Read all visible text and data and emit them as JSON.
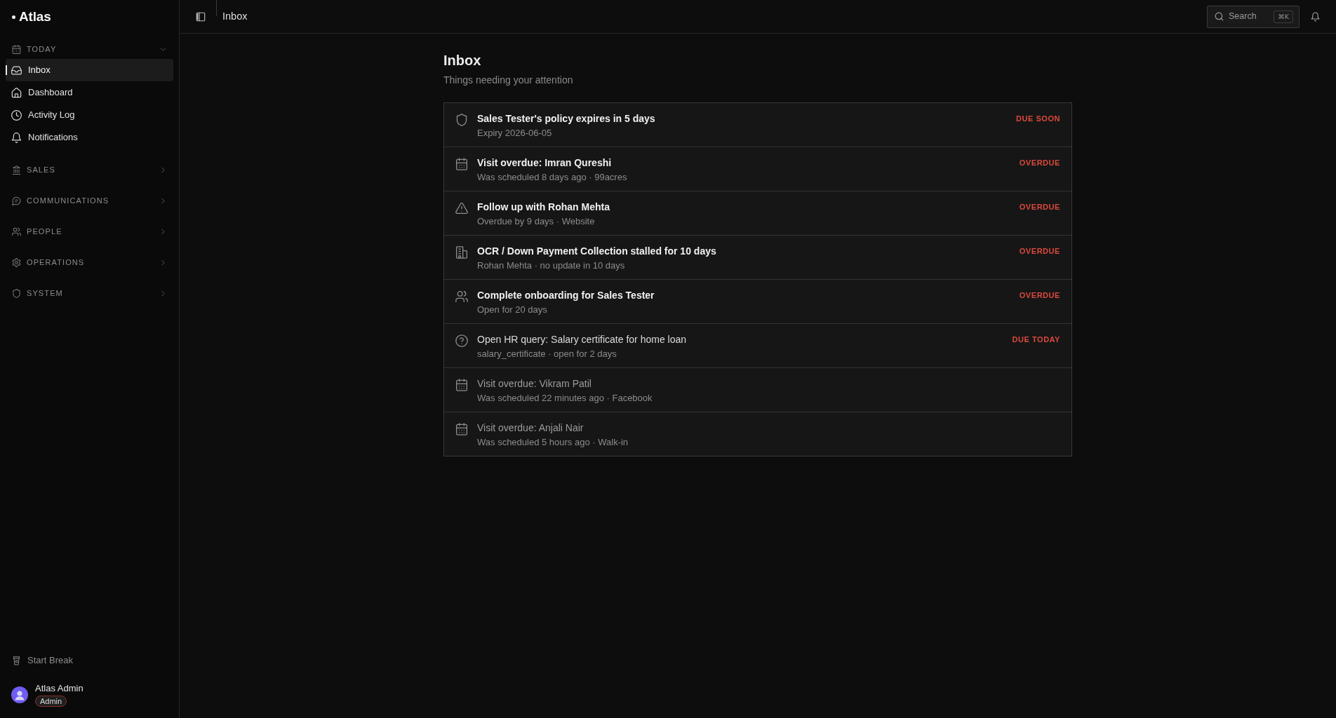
{
  "sidebar": {
    "logo": "Atlas",
    "groups": [
      {
        "kind": "today",
        "label": "TODAY",
        "expanded": true,
        "items": [
          {
            "kind": "inbox",
            "label": "Inbox",
            "selected": true
          },
          {
            "kind": "dashboard",
            "label": "Dashboard",
            "selected": false
          },
          {
            "kind": "activity",
            "label": "Activity Log",
            "selected": false
          },
          {
            "kind": "notifications",
            "label": "Notifications",
            "selected": false
          }
        ]
      },
      {
        "kind": "sales",
        "label": "SALES",
        "expanded": false
      },
      {
        "kind": "communications",
        "label": "COMMUNICATIONS",
        "expanded": false
      },
      {
        "kind": "people",
        "label": "PEOPLE",
        "expanded": false
      },
      {
        "kind": "operations",
        "label": "OPERATIONS",
        "expanded": false
      },
      {
        "kind": "system",
        "label": "SYSTEM",
        "expanded": false
      }
    ],
    "footer": {
      "break_button": "Start Break",
      "user": {
        "name": "Atlas Admin",
        "role": "Admin"
      }
    }
  },
  "topbar": {
    "title": "Inbox",
    "search": {
      "label": "Search",
      "shortcut": "⌘K"
    }
  },
  "page": {
    "title": "Inbox",
    "subtitle": "Things needing your attention"
  },
  "inbox_items": [
    {
      "kind": "policy",
      "title": "Sales Tester's policy expires in 5 days",
      "detail": "Expiry 2026-06-05",
      "status": "DUE SOON",
      "unread": true,
      "dimmed": false
    },
    {
      "kind": "visit",
      "title": "Visit overdue: Imran Qureshi",
      "detail": "Was scheduled 8 days ago · 99acres",
      "status": "OVERDUE",
      "unread": true,
      "dimmed": false
    },
    {
      "kind": "followup",
      "title": "Follow up with Rohan Mehta",
      "detail": "Overdue by 9 days · Website",
      "status": "OVERDUE",
      "unread": true,
      "dimmed": false
    },
    {
      "kind": "stalled",
      "title": "OCR / Down Payment Collection stalled for 10 days",
      "detail": "Rohan Mehta · no update in 10 days",
      "status": "OVERDUE",
      "unread": true,
      "dimmed": false
    },
    {
      "kind": "onboarding",
      "title": "Complete onboarding for Sales Tester",
      "detail": "Open for 20 days",
      "status": "OVERDUE",
      "unread": true,
      "dimmed": false
    },
    {
      "kind": "query",
      "title": "Open HR query: Salary certificate for home loan",
      "detail": "salary_certificate · open for 2 days",
      "status": "DUE TODAY",
      "unread": false,
      "dimmed": false
    },
    {
      "kind": "visit",
      "title": "Visit overdue: Vikram Patil",
      "detail": "Was scheduled 22 minutes ago · Facebook",
      "unread": false,
      "dimmed": true
    },
    {
      "kind": "visit",
      "title": "Visit overdue: Anjali Nair",
      "detail": "Was scheduled 5 hours ago · Walk-in",
      "unread": false,
      "dimmed": true
    }
  ]
}
